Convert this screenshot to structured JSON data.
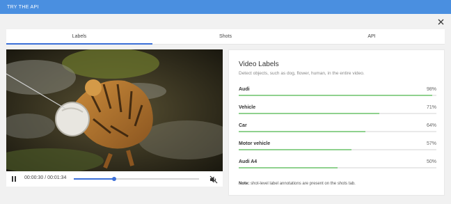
{
  "topbar": {
    "title": "TRY THE API"
  },
  "close_icon": "close-icon",
  "tabs": [
    {
      "label": "Labels",
      "active": true
    },
    {
      "label": "Shots",
      "active": false
    },
    {
      "label": "API",
      "active": false
    }
  ],
  "player": {
    "time": "00:00:30 / 00:01:34",
    "progress": 0.32,
    "pause_icon": "pause-icon",
    "mute_icon": "volume-muted-icon"
  },
  "labels_panel": {
    "title": "Video Labels",
    "description": "Detect objects, such as dog, flower, human, in the entire video.",
    "items": [
      {
        "name": "Audi",
        "percent": "98%",
        "value": 0.98
      },
      {
        "name": "Vehicle",
        "percent": "71%",
        "value": 0.71
      },
      {
        "name": "Car",
        "percent": "64%",
        "value": 0.64
      },
      {
        "name": "Motor vehicle",
        "percent": "57%",
        "value": 0.57
      },
      {
        "name": "Audi A4",
        "percent": "50%",
        "value": 0.5
      }
    ],
    "note_prefix": "Note:",
    "note_text": "shot-level label annotations are present on the shots tab."
  },
  "colors": {
    "topbar": "#4a8fe0",
    "accent": "#3b6fd8",
    "label_bar": "#8fd18e"
  }
}
